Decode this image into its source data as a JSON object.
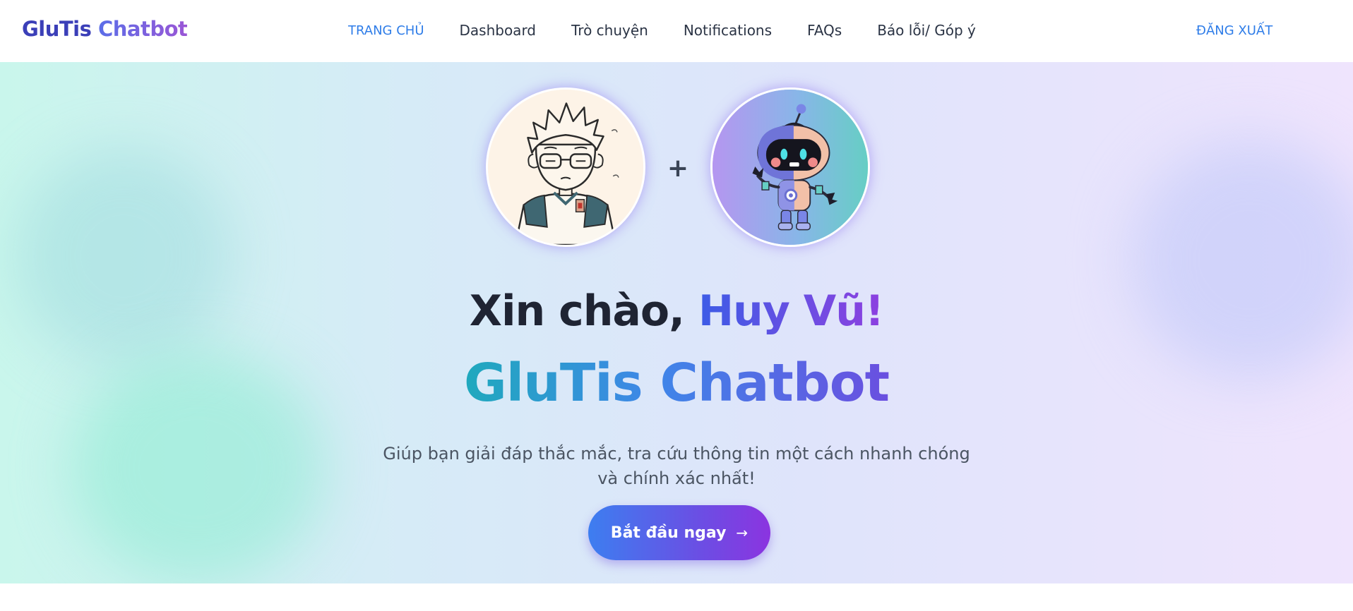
{
  "brand": {
    "part1": "GluTis",
    "part2": "Chatbot"
  },
  "nav": {
    "items": [
      {
        "label": "TRANG CHỦ"
      },
      {
        "label": "Dashboard"
      },
      {
        "label": "Trò chuyện"
      },
      {
        "label": "Notifications"
      },
      {
        "label": "FAQs"
      },
      {
        "label": "Báo lỗi/ Góp ý"
      }
    ],
    "active_index": 0,
    "logout_label": "ĐĂNG XUẤT"
  },
  "hero": {
    "plus_sign": "+",
    "greeting_prefix": "Xin chào,",
    "user_name": "Huy Vũ!",
    "title": "GluTis Chatbot",
    "subtitle": "Giúp bạn giải đáp thắc mắc, tra cứu thông tin một cách nhanh chóng và chính xác nhất!",
    "cta_label": "Bắt đầu ngay",
    "cta_icon": "→"
  },
  "icons": {
    "user_avatar": "cartoon-boy-with-glasses-avatar",
    "bot_avatar": "robot-astronaut-avatar",
    "cta_icon": "arrow-right-icon"
  },
  "colors": {
    "nav_active": "#2f7de8",
    "nav_text": "#2b3445",
    "brand_dark": "#3b3fb8",
    "brand_gradient_end": "#9a56d6",
    "cta_gradient_start": "#3d7ef0",
    "cta_gradient_end": "#8b34e0"
  }
}
